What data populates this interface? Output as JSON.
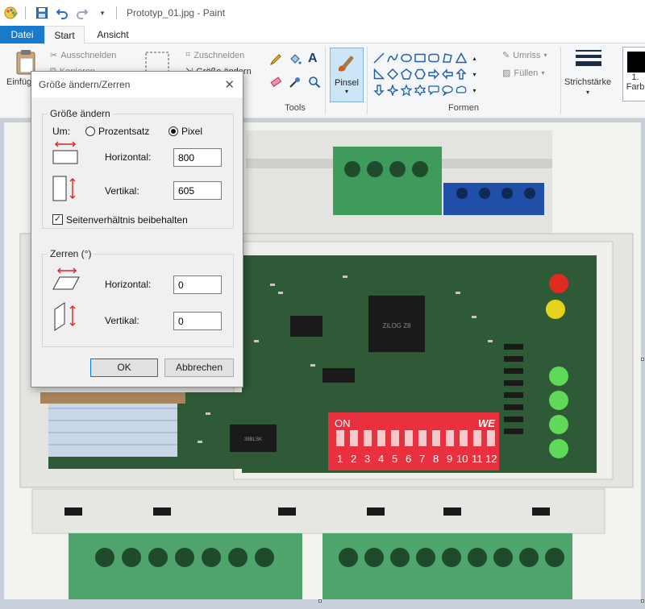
{
  "window": {
    "title": "Prototyp_01.jpg - Paint"
  },
  "tabs": [
    "Datei",
    "Start",
    "Ansicht"
  ],
  "ribbon": {
    "clipboard": {
      "paste_label": "Einfüg",
      "cut_label": "Ausschneiden",
      "copy_label": "Kopieren"
    },
    "image": {
      "crop_label": "Zuschneiden",
      "resize_label": "Größe ändern"
    },
    "tools": {
      "group_label": "Tools"
    },
    "brush": {
      "label": "Pinsel"
    },
    "shapes": {
      "group_label": "Formen",
      "outline_label": "Umriss",
      "fill_label": "Füllen"
    },
    "stroke": {
      "label": "Strichstärke"
    },
    "color1": {
      "label_num": "1.",
      "label_text": "Farb"
    }
  },
  "dialog": {
    "title": "Größe ändern/Zerren",
    "resize": {
      "legend": "Größe ändern",
      "by_label": "Um:",
      "percent_label": "Prozentsatz",
      "pixel_label": "Pixel",
      "selected": "pixel",
      "horizontal_label": "Horizontal:",
      "horizontal_value": "800",
      "vertical_label": "Vertikal:",
      "vertical_value": "605",
      "keep_ratio_label": "Seitenverhältnis beibehalten",
      "keep_ratio": true
    },
    "skew": {
      "legend": "Zerren (°)",
      "horizontal_label": "Horizontal:",
      "horizontal_value": "0",
      "vertical_label": "Vertikal:",
      "vertical_value": "0"
    },
    "ok_label": "OK",
    "cancel_label": "Abbrechen"
  },
  "photo": {
    "dip_on_label": "ON",
    "dip_we_label": "WE",
    "dip_numbers": [
      "1",
      "2",
      "3",
      "4",
      "5",
      "6",
      "7",
      "8",
      "9",
      "10",
      "11",
      "12"
    ],
    "chip_text": "ZiLOG Z8",
    "small_chip_text": "38BLSK"
  },
  "colors": {
    "accent": "#1979ca",
    "pcb_green": "#2f5a38",
    "terminal_green": "#4fa46b",
    "dip_red": "#e9303e",
    "led_red": "#e02b21",
    "led_yellow": "#e6d21c",
    "led_green": "#5fd957"
  }
}
